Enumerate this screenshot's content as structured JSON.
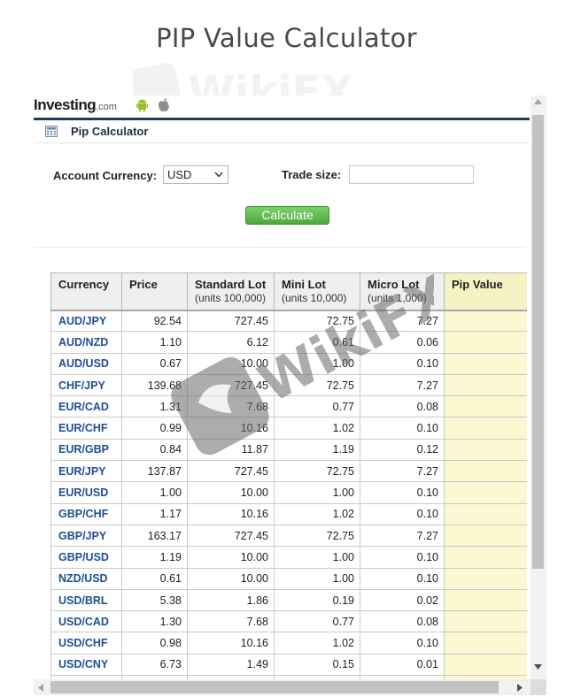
{
  "page_title": "PIP Value Calculator",
  "brand": {
    "name": "Investing",
    "suffix": ".com"
  },
  "widget_title": "Pip Calculator",
  "form": {
    "account_currency_label": "Account Currency:",
    "account_currency_value": "USD",
    "trade_size_label": "Trade size:",
    "trade_size_value": "",
    "calculate_label": "Calculate"
  },
  "table": {
    "headers": [
      {
        "main": "Currency",
        "sub": ""
      },
      {
        "main": "Price",
        "sub": ""
      },
      {
        "main": "Standard Lot",
        "sub": "(units 100,000)"
      },
      {
        "main": "Mini Lot",
        "sub": "(units 10,000)"
      },
      {
        "main": "Micro Lot",
        "sub": "(units 1,000)"
      },
      {
        "main": "Pip Value",
        "sub": ""
      }
    ],
    "rows": [
      [
        "AUD/JPY",
        "92.54",
        "727.45",
        "72.75",
        "7.27",
        ""
      ],
      [
        "AUD/NZD",
        "1.10",
        "6.12",
        "0.61",
        "0.06",
        ""
      ],
      [
        "AUD/USD",
        "0.67",
        "10.00",
        "1.00",
        "0.10",
        ""
      ],
      [
        "CHF/JPY",
        "139.68",
        "727.45",
        "72.75",
        "7.27",
        ""
      ],
      [
        "EUR/CAD",
        "1.31",
        "7.68",
        "0.77",
        "0.08",
        ""
      ],
      [
        "EUR/CHF",
        "0.99",
        "10.16",
        "1.02",
        "0.10",
        ""
      ],
      [
        "EUR/GBP",
        "0.84",
        "11.87",
        "1.19",
        "0.12",
        ""
      ],
      [
        "EUR/JPY",
        "137.87",
        "727.45",
        "72.75",
        "7.27",
        ""
      ],
      [
        "EUR/USD",
        "1.00",
        "10.00",
        "1.00",
        "0.10",
        ""
      ],
      [
        "GBP/CHF",
        "1.17",
        "10.16",
        "1.02",
        "0.10",
        ""
      ],
      [
        "GBP/JPY",
        "163.17",
        "727.45",
        "72.75",
        "7.27",
        ""
      ],
      [
        "GBP/USD",
        "1.19",
        "10.00",
        "1.00",
        "0.10",
        ""
      ],
      [
        "NZD/USD",
        "0.61",
        "10.00",
        "1.00",
        "0.10",
        ""
      ],
      [
        "USD/BRL",
        "5.38",
        "1.86",
        "0.19",
        "0.02",
        ""
      ],
      [
        "USD/CAD",
        "1.30",
        "7.68",
        "0.77",
        "0.08",
        ""
      ],
      [
        "USD/CHF",
        "0.98",
        "10.16",
        "1.02",
        "0.10",
        ""
      ],
      [
        "USD/CNY",
        "6.73",
        "1.49",
        "0.15",
        "0.01",
        ""
      ],
      [
        "USD/HKD",
        "",
        "",
        "",
        "",
        ""
      ]
    ]
  },
  "watermark_text": "WikiFX",
  "colors": {
    "brand_navy": "#1f3a60",
    "pair_link": "#1f4e96",
    "pip_column": "#fbf8d2",
    "calculate_green": "#4ea93e"
  }
}
